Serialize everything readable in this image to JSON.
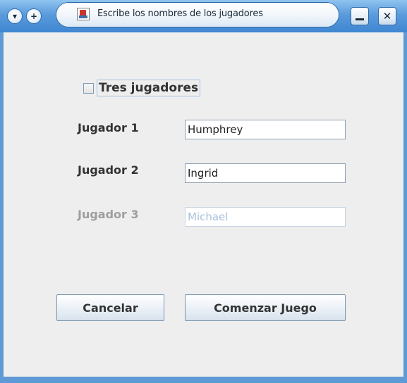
{
  "window": {
    "title": "Escribe los nombres de los jugadores",
    "icons": {
      "menu": "window-menu-icon",
      "stick": "stick-icon",
      "app": "java-app-icon",
      "minimize": "minimize-icon",
      "close": "close-icon"
    },
    "colors": {
      "title_bar": "#5a9bdb",
      "client_bg": "#eeeeee"
    }
  },
  "form": {
    "three_players": {
      "label": "Tres jugadores",
      "checked": false
    },
    "players": [
      {
        "label": "Jugador 1",
        "value": "Humphrey",
        "enabled": true
      },
      {
        "label": "Jugador 2",
        "value": "Ingrid",
        "enabled": true
      },
      {
        "label": "Jugador 3",
        "value": "Michael",
        "enabled": false
      }
    ]
  },
  "buttons": {
    "cancel": "Cancelar",
    "start": "Comenzar Juego"
  }
}
